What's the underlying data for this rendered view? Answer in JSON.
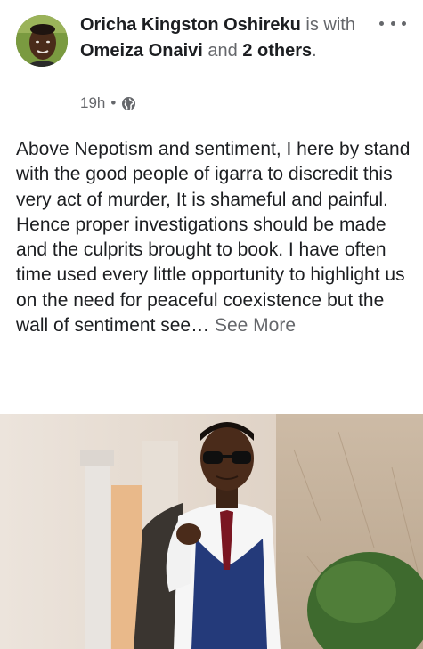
{
  "post": {
    "author": "Oricha Kingston Oshireku",
    "is_with": "is with",
    "tagged_person": "Omeiza Onaivi",
    "and_text": "and",
    "others": "2 others",
    "period": ".",
    "time": "19h",
    "separator": "•",
    "privacy_icon": "globe-icon",
    "body_text": "Above Nepotism and sentiment, I here by stand with the good people of igarra to discredit this very act of murder, It is shameful and painful. Hence proper investigations should be made and the culprits brought to book. I have often time used every little opportunity to highlight us on the need for peaceful coexistence but the wall of sentiment see…",
    "see_more": "See More"
  },
  "colors": {
    "text": "#1c1e21",
    "secondary": "#65676b",
    "background": "#ffffff"
  }
}
